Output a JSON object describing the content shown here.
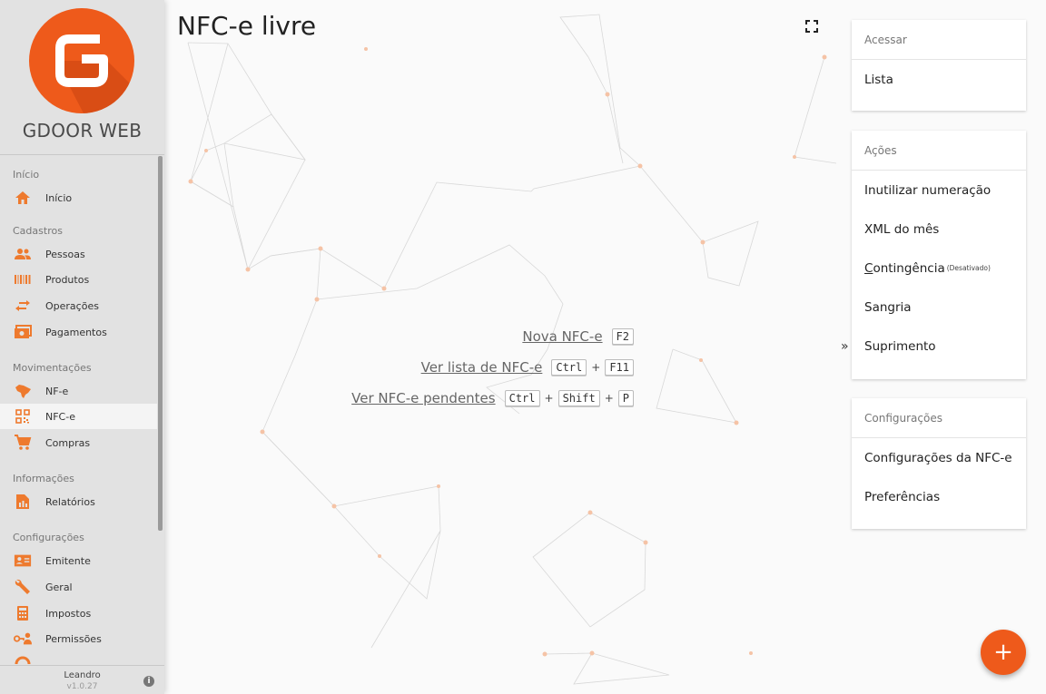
{
  "brand": {
    "name": "GDOOR WEB",
    "accent": "#ee5a1b"
  },
  "sidebar": {
    "sections": [
      {
        "label": "Início",
        "items": [
          {
            "label": "Início",
            "icon": "home-icon"
          }
        ]
      },
      {
        "label": "Cadastros",
        "items": [
          {
            "label": "Pessoas",
            "icon": "people-icon"
          },
          {
            "label": "Produtos",
            "icon": "barcode-icon"
          },
          {
            "label": "Operações",
            "icon": "swap-icon"
          },
          {
            "label": "Pagamentos",
            "icon": "money-icon"
          }
        ]
      },
      {
        "label": "Movimentações",
        "items": [
          {
            "label": "NF-e",
            "icon": "brazil-map-icon"
          },
          {
            "label": "NFC-e",
            "icon": "qrcode-icon",
            "active": true
          },
          {
            "label": "Compras",
            "icon": "cart-icon"
          }
        ]
      },
      {
        "label": "Informações",
        "items": [
          {
            "label": "Relatórios",
            "icon": "report-icon"
          }
        ]
      },
      {
        "label": "Configurações",
        "items": [
          {
            "label": "Emitente",
            "icon": "id-card-icon"
          },
          {
            "label": "Geral",
            "icon": "wrench-icon"
          },
          {
            "label": "Impostos",
            "icon": "calculator-icon"
          },
          {
            "label": "Permissões",
            "icon": "key-person-icon"
          }
        ]
      }
    ],
    "footer": {
      "user": "Leandro",
      "version": "v1.0.27"
    }
  },
  "main": {
    "title": "NFC-e livre",
    "shortcuts": [
      {
        "label": "Nova NFC-e",
        "keys": [
          "F2"
        ]
      },
      {
        "label": "Ver lista de NFC-e",
        "keys": [
          "Ctrl",
          "F11"
        ]
      },
      {
        "label": "Ver NFC-e pendentes",
        "keys": [
          "Ctrl",
          "Shift",
          "P"
        ]
      }
    ],
    "collapse_label": "»"
  },
  "panel": {
    "cards": [
      {
        "header": "Acessar",
        "items": [
          {
            "label": "Lista"
          }
        ]
      },
      {
        "header": "Ações",
        "items": [
          {
            "label": "Inutilizar numeração"
          },
          {
            "label": "XML do mês"
          },
          {
            "label": "Contingência",
            "note": "(Desativado)"
          },
          {
            "label": "Sangria"
          },
          {
            "label": "Suprimento"
          }
        ]
      },
      {
        "header": "Configurações",
        "items": [
          {
            "label": "Configurações da NFC-e"
          },
          {
            "label": "Preferências"
          }
        ]
      }
    ],
    "fab_label": "+"
  }
}
